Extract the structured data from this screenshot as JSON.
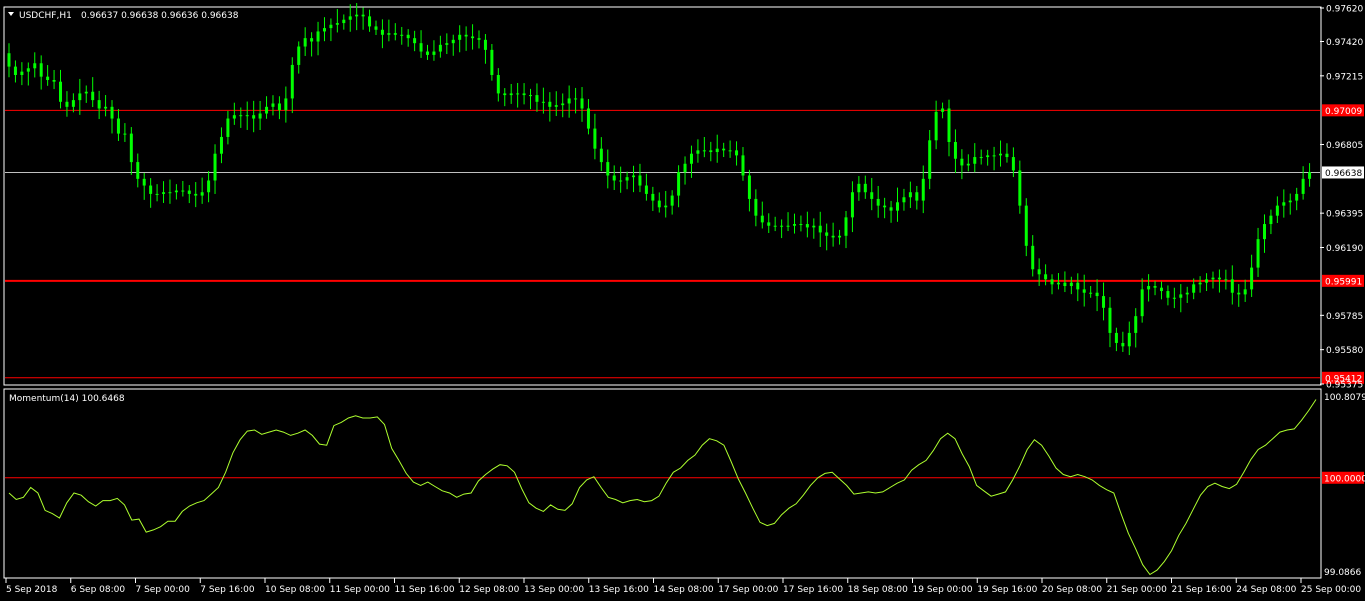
{
  "chart_data": [
    {
      "type": "candlestick",
      "symbol_label": "USDCHF,H1",
      "ohlc_label": "0.96637 0.96638 0.96636 0.96638",
      "colors": {
        "background": "#000000",
        "candles": "#00ff00",
        "hline": "#ff0000",
        "bid_line": "#c0c0c0",
        "axis": "#ffffff"
      },
      "ylim": [
        0.95375,
        0.9762
      ],
      "y_ticks": [
        "0.97620",
        "0.97420",
        "0.97215",
        "0.96805",
        "0.96395",
        "0.96190",
        "0.95785",
        "0.95580",
        "0.95375"
      ],
      "y_tick_values": [
        0.9762,
        0.9742,
        0.97215,
        0.96805,
        0.96395,
        0.9619,
        0.95785,
        0.9558,
        0.95375
      ],
      "price_labels": [
        {
          "text": "0.97009",
          "value": 0.97009,
          "kind": "hline"
        },
        {
          "text": "0.96638",
          "value": 0.96638,
          "kind": "bid"
        },
        {
          "text": "0.95991",
          "value": 0.95991,
          "kind": "hline"
        },
        {
          "text": "0.95412",
          "value": 0.95412,
          "kind": "hline"
        }
      ],
      "close_series": [
        0.9727,
        0.9722,
        0.9724,
        0.9726,
        0.9729,
        0.9721,
        0.9719,
        0.9718,
        0.9706,
        0.9703,
        0.9707,
        0.9711,
        0.9712,
        0.9707,
        0.9702,
        0.9703,
        0.9696,
        0.9687,
        0.9687,
        0.967,
        0.966,
        0.9656,
        0.9651,
        0.9651,
        0.9652,
        0.9652,
        0.9653,
        0.9653,
        0.9651,
        0.965,
        0.9652,
        0.9659,
        0.9675,
        0.9685,
        0.9696,
        0.9698,
        0.9698,
        0.9698,
        0.9696,
        0.9699,
        0.9703,
        0.9705,
        0.9701,
        0.9708,
        0.9728,
        0.9739,
        0.9744,
        0.9742,
        0.9748,
        0.975,
        0.9752,
        0.9753,
        0.9755,
        0.9757,
        0.9758,
        0.9757,
        0.9751,
        0.9749,
        0.9746,
        0.9747,
        0.9746,
        0.9746,
        0.9744,
        0.9741,
        0.9736,
        0.9734,
        0.9736,
        0.974,
        0.9741,
        0.9743,
        0.9746,
        0.9745,
        0.9744,
        0.9743,
        0.9737,
        0.9722,
        0.9711,
        0.971,
        0.9711,
        0.9711,
        0.971,
        0.971,
        0.9706,
        0.9706,
        0.9703,
        0.9704,
        0.9705,
        0.9708,
        0.9708,
        0.9702,
        0.969,
        0.9678,
        0.967,
        0.9662,
        0.9659,
        0.9659,
        0.9661,
        0.9662,
        0.9656,
        0.9651,
        0.9647,
        0.9643,
        0.9644,
        0.965,
        0.9664,
        0.9669,
        0.9675,
        0.9677,
        0.9677,
        0.9676,
        0.9678,
        0.9677,
        0.9677,
        0.9674,
        0.9662,
        0.9648,
        0.9638,
        0.9634,
        0.9632,
        0.9632,
        0.9632,
        0.9632,
        0.9633,
        0.9633,
        0.9631,
        0.9632,
        0.9628,
        0.9626,
        0.9625,
        0.9626,
        0.9637,
        0.9652,
        0.9657,
        0.9652,
        0.9648,
        0.9644,
        0.9643,
        0.9641,
        0.9646,
        0.9649,
        0.9652,
        0.9647,
        0.966,
        0.9683,
        0.97,
        0.9702,
        0.9682,
        0.9672,
        0.9668,
        0.9669,
        0.9673,
        0.9673,
        0.9674,
        0.9674,
        0.9675,
        0.9673,
        0.9665,
        0.9644,
        0.962,
        0.9606,
        0.9603,
        0.96,
        0.9597,
        0.9598,
        0.9596,
        0.9598,
        0.9594,
        0.9592,
        0.9592,
        0.959,
        0.9583,
        0.9568,
        0.9562,
        0.956,
        0.9568,
        0.9578,
        0.9594,
        0.9596,
        0.9595,
        0.9593,
        0.9589,
        0.9589,
        0.9591,
        0.9592,
        0.9597,
        0.9598,
        0.96,
        0.9601,
        0.96,
        0.96,
        0.9592,
        0.9591,
        0.9594,
        0.9607,
        0.9624,
        0.9633,
        0.9638,
        0.9644,
        0.9646,
        0.9647,
        0.9651,
        0.966,
        0.9664
      ]
    },
    {
      "type": "line",
      "title": "Momentum(14) 100.6468",
      "colors": {
        "line": "#adff2f",
        "level": "#ff0000"
      },
      "ylim": [
        99.0866,
        100.8079
      ],
      "y_ticks": [
        "100.8079",
        "99.0866"
      ],
      "level_label": "100.0000",
      "level_value": 100.0,
      "series": [
        {
          "values": [
            99.86,
            99.8,
            99.82,
            99.91,
            99.86,
            99.7,
            99.67,
            99.63,
            99.77,
            99.86,
            99.84,
            99.78,
            99.74,
            99.79,
            99.79,
            99.81,
            99.75,
            99.61,
            99.62,
            99.5,
            99.52,
            99.55,
            99.6,
            99.6,
            99.69,
            99.74,
            99.77,
            99.79,
            99.85,
            99.91,
            100.05,
            100.23,
            100.35,
            100.43,
            100.44,
            100.4,
            100.42,
            100.44,
            100.42,
            100.39,
            100.41,
            100.44,
            100.39,
            100.31,
            100.3,
            100.48,
            100.51,
            100.55,
            100.57,
            100.55,
            100.55,
            100.56,
            100.49,
            100.27,
            100.16,
            100.04,
            99.96,
            99.93,
            99.96,
            99.92,
            99.88,
            99.86,
            99.82,
            99.85,
            99.86,
            99.97,
            100.03,
            100.08,
            100.12,
            100.11,
            100.05,
            99.9,
            99.77,
            99.72,
            99.69,
            99.75,
            99.71,
            99.7,
            99.76,
            99.91,
            99.98,
            100.01,
            99.91,
            99.82,
            99.8,
            99.77,
            99.79,
            99.8,
            99.78,
            99.79,
            99.83,
            99.95,
            100.05,
            100.09,
            100.16,
            100.21,
            100.3,
            100.36,
            100.34,
            100.3,
            100.15,
            99.99,
            99.86,
            99.72,
            99.59,
            99.56,
            99.58,
            99.66,
            99.72,
            99.76,
            99.84,
            99.93,
            100.0,
            100.04,
            100.05,
            99.99,
            99.93,
            99.85,
            99.86,
            99.87,
            99.86,
            99.87,
            99.91,
            99.95,
            99.98,
            100.07,
            100.12,
            100.16,
            100.25,
            100.36,
            100.41,
            100.36,
            100.22,
            100.1,
            99.93,
            99.88,
            99.83,
            99.85,
            99.87,
            99.98,
            100.11,
            100.26,
            100.35,
            100.3,
            100.2,
            100.09,
            100.03,
            100.01,
            100.03,
            100.01,
            99.98,
            99.93,
            99.89,
            99.86,
            99.67,
            99.49,
            99.35,
            99.2,
            99.11,
            99.15,
            99.23,
            99.33,
            99.47,
            99.58,
            99.71,
            99.84,
            99.92,
            99.95,
            99.92,
            99.9,
            99.94,
            100.05,
            100.17,
            100.26,
            100.3,
            100.36,
            100.42,
            100.44,
            100.45,
            100.53,
            100.62,
            100.72
          ]
        }
      ]
    }
  ],
  "x_ticks": [
    "5 Sep 2018",
    "6 Sep 08:00",
    "7 Sep 00:00",
    "7 Sep 16:00",
    "10 Sep 08:00",
    "11 Sep 00:00",
    "11 Sep 16:00",
    "12 Sep 08:00",
    "13 Sep 00:00",
    "13 Sep 16:00",
    "14 Sep 08:00",
    "17 Sep 00:00",
    "17 Sep 16:00",
    "18 Sep 08:00",
    "19 Sep 00:00",
    "19 Sep 16:00",
    "20 Sep 08:00",
    "21 Sep 00:00",
    "21 Sep 16:00",
    "24 Sep 08:00",
    "25 Sep 00:00"
  ]
}
